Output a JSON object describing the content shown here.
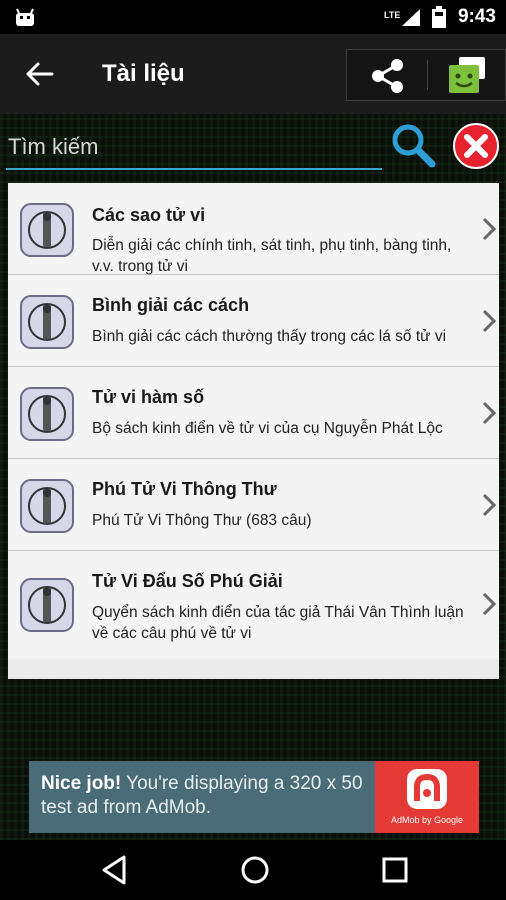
{
  "status": {
    "time": "9:43",
    "network": "LTE"
  },
  "appbar": {
    "title": "Tài liệu"
  },
  "search": {
    "placeholder": "Tìm kiếm"
  },
  "list": {
    "items": [
      {
        "title": "Các sao tử vi",
        "desc": "Diễn giải các chính tinh, sát tinh, phụ tinh, bàng tinh, v.v. trong tử vi"
      },
      {
        "title": "Bình giải các cách",
        "desc": "Bình giải các cách thường thấy trong các lá số tử vi"
      },
      {
        "title": "Tử vi hàm số",
        "desc": "Bộ sách kinh điển về tử vi của cụ Nguyễn Phát Lộc"
      },
      {
        "title": "Phú Tử Vi Thông Thư",
        "desc": "Phú Tử Vi Thông Thư (683 câu)"
      },
      {
        "title": "Tử Vi Đẩu Số Phú Giải",
        "desc": "Quyển sách kinh điển của tác giả Thái Vân Thình luận về các câu phú về tử vi"
      }
    ]
  },
  "ad": {
    "strong": "Nice job!",
    "text": " You're displaying a 320 x 50 test ad from AdMob.",
    "logo_caption": "AdMob by Google"
  },
  "colors": {
    "accent": "#3aa6c9",
    "ad_bg": "#4a6b78",
    "ad_logo": "#e53935",
    "chat_icon": "#7cc03c"
  }
}
